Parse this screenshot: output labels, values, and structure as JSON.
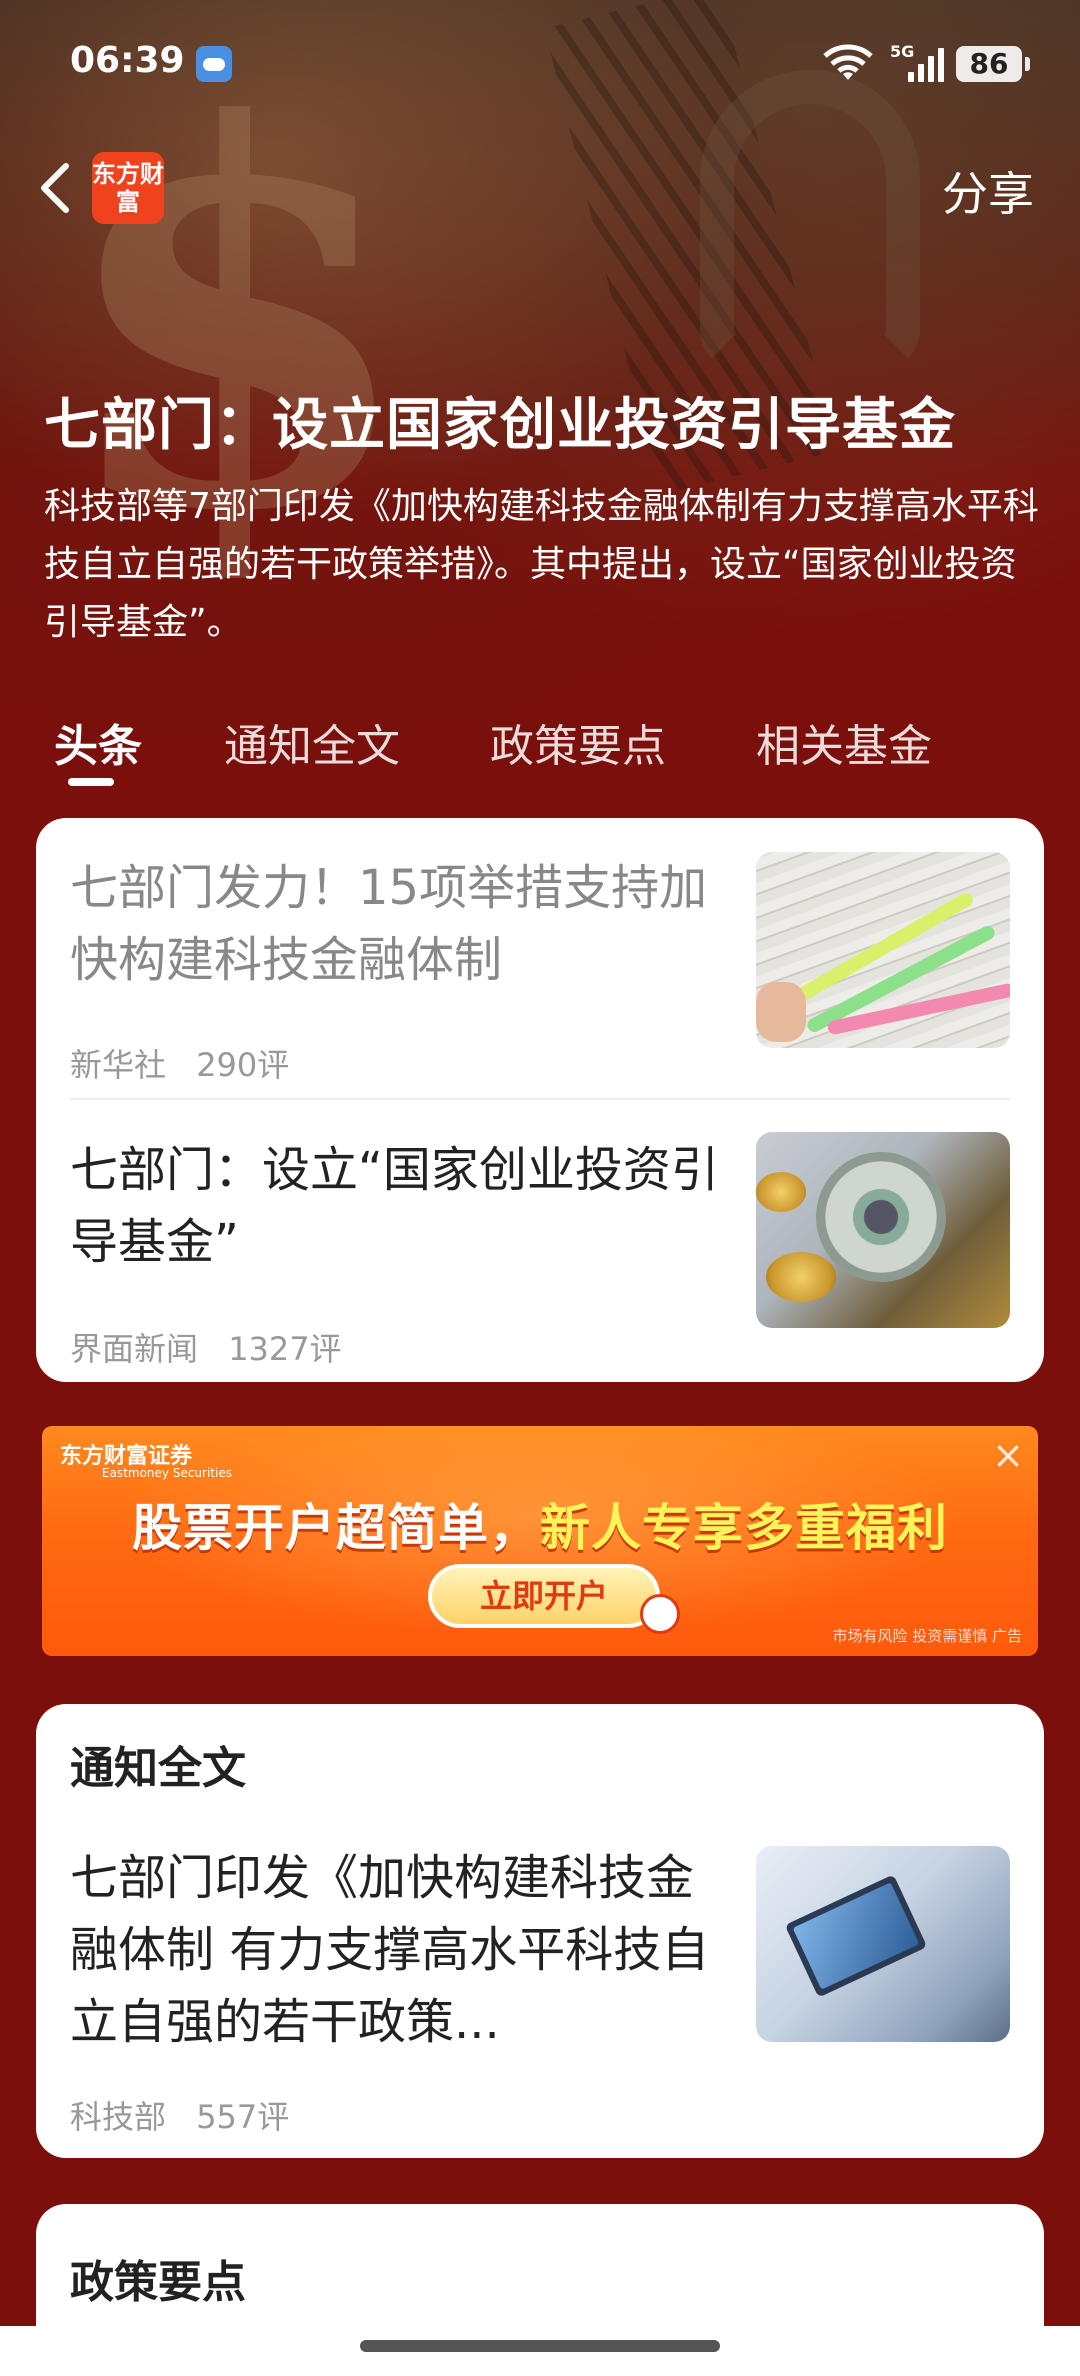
{
  "status_bar": {
    "time": "06:39",
    "signal_label": "5G",
    "battery": "86"
  },
  "nav": {
    "logo_text": "东方财富",
    "share_label": "分享"
  },
  "topic": {
    "title": "七部门：设立国家创业投资引导基金",
    "description": "科技部等7部门印发《加快构建科技金融体制有力支撑高水平科技自立自强的若干政策举措》。其中提出，设立“国家创业投资引导基金”。"
  },
  "tabs": [
    {
      "label": "头条",
      "active": true
    },
    {
      "label": "通知全文",
      "active": false
    },
    {
      "label": "政策要点",
      "active": false
    },
    {
      "label": "相关基金",
      "active": false
    }
  ],
  "headlines": [
    {
      "title": "七部门发力！15项举措支持加快构建科技金融体制",
      "source": "新华社",
      "comments": "290评",
      "read": true
    },
    {
      "title": "七部门：设立“国家创业投资引导基金”",
      "source": "界面新闻",
      "comments": "1327评",
      "read": false
    }
  ],
  "ad": {
    "brand": "东方财富证券",
    "brand_en": "Eastmoney Securities",
    "headline_part1": "股票开户超简单，",
    "headline_part2": "新人专享多重福利",
    "cta": "立即开户",
    "note": "市场有风险 投资需谨慎 广告"
  },
  "notice_section": {
    "heading": "通知全文",
    "item": {
      "title": "七部门印发《加快构建科技金融体制 有力支撑高水平科技自立自强的若干政策...",
      "source": "科技部",
      "comments": "557评"
    }
  },
  "policy_section": {
    "heading": "政策要点"
  },
  "colors": {
    "page_red": "#7a0f0b",
    "logo_orange": "#f0431d",
    "ad_orange": "#ff6a12"
  }
}
